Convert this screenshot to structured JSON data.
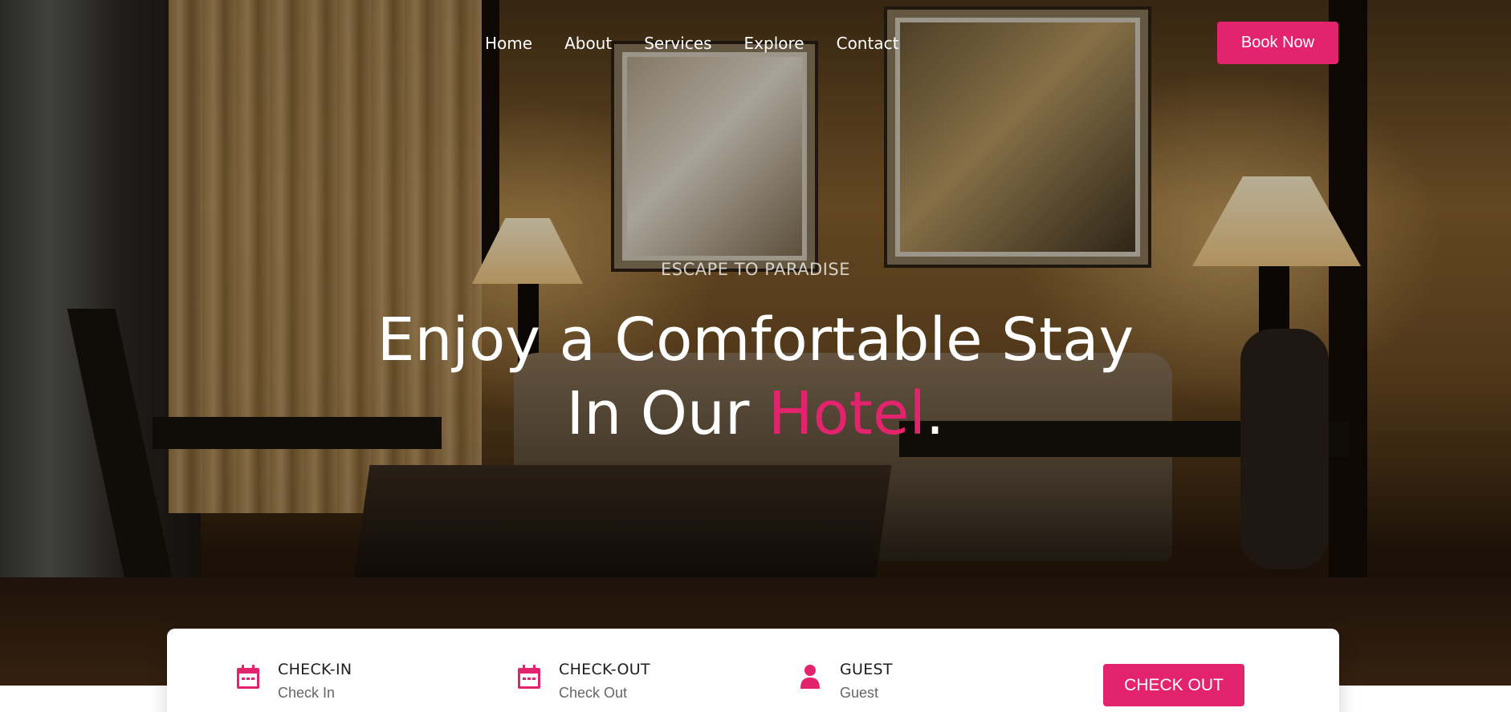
{
  "nav": {
    "items": [
      {
        "label": "Home"
      },
      {
        "label": "About"
      },
      {
        "label": "Services"
      },
      {
        "label": "Explore"
      },
      {
        "label": "Contact"
      }
    ],
    "cta_label": "Book Now"
  },
  "hero": {
    "tagline": "ESCAPE TO PARADISE",
    "headline_line1": "Enjoy a Comfortable Stay",
    "headline_line2_prefix": "In Our ",
    "headline_accent": "Hotel",
    "headline_suffix": "."
  },
  "booking": {
    "check_in": {
      "title": "CHECK-IN",
      "value": "Check In",
      "icon": "calendar-icon"
    },
    "check_out": {
      "title": "CHECK-OUT",
      "value": "Check Out",
      "icon": "calendar-icon"
    },
    "guest": {
      "title": "GUEST",
      "value": "Guest",
      "icon": "user-icon"
    },
    "submit_label": "CHECK OUT"
  },
  "colors": {
    "accent": "#e4236e",
    "text_dark": "#1d1d1d"
  }
}
